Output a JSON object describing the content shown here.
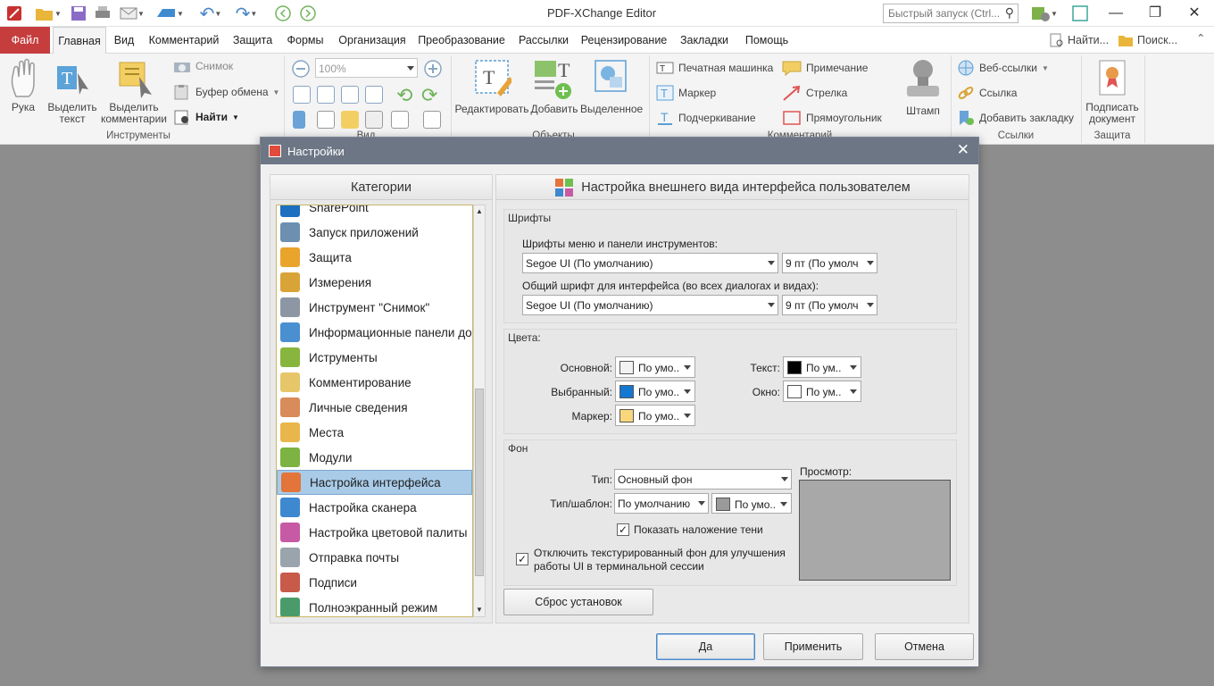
{
  "app": {
    "title": "PDF-XChange Editor"
  },
  "quick_search": {
    "placeholder": "Быстрый запуск (Ctrl..."
  },
  "menu": {
    "tabs": [
      "Файл",
      "Главная",
      "Вид",
      "Комментарий",
      "Защита",
      "Формы",
      "Организация",
      "Преобразование",
      "Рассылки",
      "Рецензирование",
      "Закладки",
      "Помощь"
    ],
    "find_label": "Найти...",
    "search_label": "Поиск..."
  },
  "ribbon": {
    "hand": "Рука",
    "select_text": "Выделить текст",
    "select_comments": "Выделить комментарии",
    "snapshot": "Снимок",
    "clipboard": "Буфер обмена",
    "find": "Найти",
    "zoom": "100%",
    "edit": "Редактировать",
    "add": "Добавить",
    "selected": "Выделенное",
    "typewriter": "Печатная машинка",
    "note": "Примечание",
    "marker": "Маркер",
    "arrow": "Стрелка",
    "underline": "Подчеркивание",
    "rectangle": "Прямоугольник",
    "stamp": "Штамп",
    "web_links": "Веб-ссылки",
    "link": "Ссылка",
    "add_bookmark": "Добавить закладку",
    "sign_document": "Подписать документ",
    "groups": {
      "tools": "Инструменты",
      "view": "Вид",
      "objects": "Объекты",
      "comments": "Комментарий",
      "links": "Ссылки",
      "protect": "Защита"
    }
  },
  "dialog": {
    "title": "Настройки",
    "categories_header": "Категории",
    "right_header": "Настройка внешнего вида интерфейса пользователем",
    "categories": [
      {
        "label": "SharePoint",
        "color": "#1d6fbf"
      },
      {
        "label": "Запуск приложений",
        "color": "#6d8fb0"
      },
      {
        "label": "Защита",
        "color": "#e9a42c"
      },
      {
        "label": "Измерения",
        "color": "#d9a437"
      },
      {
        "label": "Инструмент \"Снимок\"",
        "color": "#8c97a3"
      },
      {
        "label": "Информационные панели до",
        "color": "#4a8fd0"
      },
      {
        "label": "Иструменты",
        "color": "#88b53d"
      },
      {
        "label": "Комментирование",
        "color": "#e7c66a"
      },
      {
        "label": "Личные сведения",
        "color": "#d88b5b"
      },
      {
        "label": "Места",
        "color": "#e8b64a"
      },
      {
        "label": "Модули",
        "color": "#7cb342"
      },
      {
        "label": "Настройка интерфейса",
        "color": "#e3743a"
      },
      {
        "label": "Настройка сканера",
        "color": "#3e88cf"
      },
      {
        "label": "Настройка цветовой палиты",
        "color": "#c75aa5"
      },
      {
        "label": "Отправка почты",
        "color": "#9aa4ad"
      },
      {
        "label": "Подписи",
        "color": "#c85a4a"
      },
      {
        "label": "Полноэкранный режим",
        "color": "#4b9b6a"
      }
    ],
    "fonts": {
      "title": "Шрифты",
      "menu_font_label": "Шрифты меню и панели инструментов:",
      "menu_font": "Segoe UI (По умолчанию)",
      "menu_size": "9 пт (По умолч",
      "ui_font_label": "Общий шрифт для интерфейса (во всех диалогах и видах):",
      "ui_font": "Segoe UI (По умолчанию)",
      "ui_size": "9 пт (По умолч"
    },
    "colors": {
      "title": "Цвета:",
      "primary_label": "Основной:",
      "primary_value": "По умо..",
      "primary_color": "#f2f2f2",
      "selected_label": "Выбранный:",
      "selected_value": "По умо..",
      "selected_color": "#1478d2",
      "marker_label": "Маркер:",
      "marker_value": "По умо..",
      "marker_color": "#f8d77c",
      "text_label": "Текст:",
      "text_value": "По ум..",
      "text_color": "#000000",
      "window_label": "Окно:",
      "window_value": "По ум..",
      "window_color": "#ffffff"
    },
    "background": {
      "title": "Фон",
      "type_label": "Тип:",
      "type_value": "Основный фон",
      "pattern_label": "Тип/шаблон:",
      "pattern_value": "По умолчанию",
      "pattern_color_value": "По умо..",
      "pattern_color": "#9a9a9a",
      "shadow_checkbox": "Показать наложение тени",
      "shadow_checked": true,
      "terminal_checkbox": "Отключить текстурированный фон для улучшения работы UI в терминальной сессии",
      "terminal_checked": true,
      "preview_label": "Просмотр:"
    },
    "reset_button": "Сброс установок",
    "ok_button": "Да",
    "apply_button": "Применить",
    "cancel_button": "Отмена"
  }
}
